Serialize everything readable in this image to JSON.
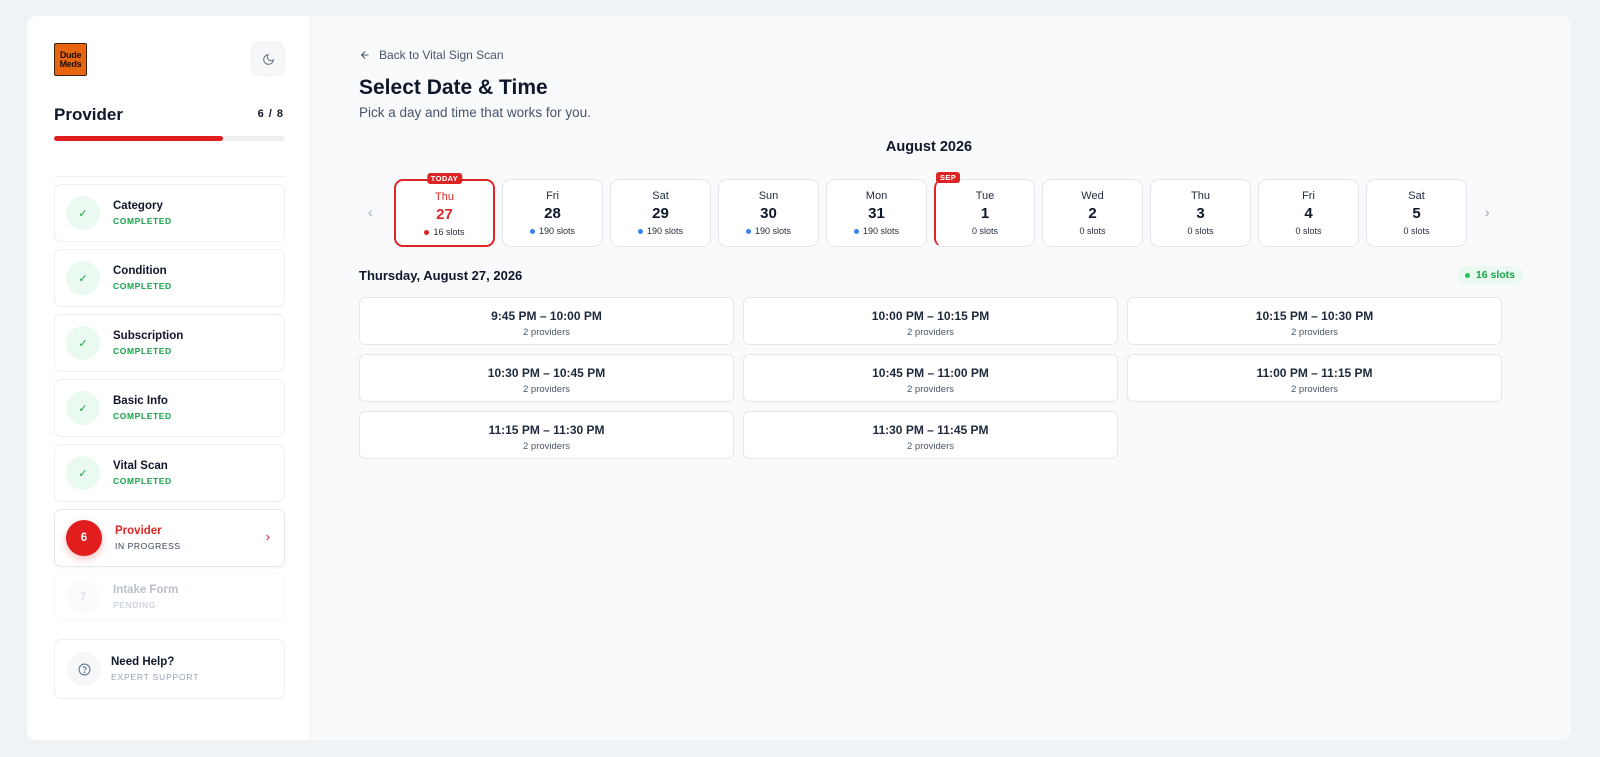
{
  "brand": {
    "logo_line1": "Dude",
    "logo_line2": "Meds"
  },
  "sidebar": {
    "title": "Provider",
    "count": "6 / 8",
    "progress": 0.73,
    "steps": [
      {
        "name": "Category",
        "status": "COMPLETED",
        "marker": "✓"
      },
      {
        "name": "Condition",
        "status": "COMPLETED",
        "marker": "✓"
      },
      {
        "name": "Subscription",
        "status": "COMPLETED",
        "marker": "✓"
      },
      {
        "name": "Basic Info",
        "status": "COMPLETED",
        "marker": "✓"
      },
      {
        "name": "Vital Scan",
        "status": "COMPLETED",
        "marker": "✓"
      },
      {
        "name": "Provider",
        "status": "IN PROGRESS",
        "marker": "6"
      },
      {
        "name": "Intake Form",
        "status": "PENDING",
        "marker": "7"
      }
    ],
    "help": {
      "title": "Need Help?",
      "subtitle": "EXPERT SUPPORT"
    }
  },
  "main": {
    "back_label": "Back to Vital Sign Scan",
    "title": "Select Date & Time",
    "subtitle": "Pick a day and time that works for you.",
    "month": "August 2026",
    "days": [
      {
        "dow": "Thu",
        "num": "27",
        "slots": "16 slots",
        "badge": "TODAY",
        "dot_color": "#dc2626"
      },
      {
        "dow": "Fri",
        "num": "28",
        "slots": "190 slots",
        "dot_color": "#3b82f6"
      },
      {
        "dow": "Sat",
        "num": "29",
        "slots": "190 slots",
        "dot_color": "#3b82f6"
      },
      {
        "dow": "Sun",
        "num": "30",
        "slots": "190 slots",
        "dot_color": "#3b82f6"
      },
      {
        "dow": "Mon",
        "num": "31",
        "slots": "190 slots",
        "dot_color": "#3b82f6"
      },
      {
        "dow": "Tue",
        "num": "1",
        "slots": "0 slots",
        "badge": "SEP"
      },
      {
        "dow": "Wed",
        "num": "2",
        "slots": "0 slots"
      },
      {
        "dow": "Thu",
        "num": "3",
        "slots": "0 slots"
      },
      {
        "dow": "Fri",
        "num": "4",
        "slots": "0 slots"
      },
      {
        "dow": "Sat",
        "num": "5",
        "slots": "0 slots"
      }
    ],
    "selected_date": "Thursday, August 27, 2026",
    "slots_count": "16 slots",
    "times": [
      {
        "range": "9:45 PM – 10:00 PM",
        "providers": "2 providers"
      },
      {
        "range": "10:00 PM – 10:15 PM",
        "providers": "2 providers"
      },
      {
        "range": "10:15 PM – 10:30 PM",
        "providers": "2 providers"
      },
      {
        "range": "10:30 PM – 10:45 PM",
        "providers": "2 providers"
      },
      {
        "range": "10:45 PM – 11:00 PM",
        "providers": "2 providers"
      },
      {
        "range": "11:00 PM – 11:15 PM",
        "providers": "2 providers"
      },
      {
        "range": "11:15 PM – 11:30 PM",
        "providers": "2 providers"
      },
      {
        "range": "11:30 PM – 11:45 PM",
        "providers": "2 providers"
      }
    ]
  },
  "colors": {
    "accent": "#dc2626",
    "success": "#16a34a",
    "info": "#3b82f6"
  },
  "icons": {
    "theme": "moon-icon",
    "back": "arrow-left-icon",
    "help": "question-circle-icon",
    "prev": "chevron-left-icon",
    "next": "chevron-right-icon"
  }
}
